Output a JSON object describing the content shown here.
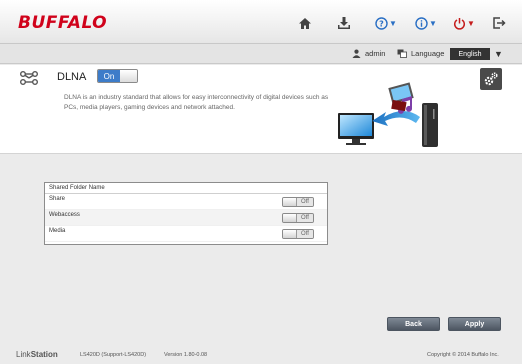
{
  "header": {
    "logo": "BUFFALO",
    "icons": [
      "home-icon",
      "download-icon",
      "help-icon",
      "info-icon",
      "power-icon",
      "logout-icon"
    ]
  },
  "userbar": {
    "user": "admin",
    "language_label": "Language",
    "language_value": "English"
  },
  "dlna": {
    "title": "DLNA",
    "toggle": "On",
    "description": "DLNA is an industry standard that allows for easy interconnectivity of digital devices such as PCs, media players, gaming devices and network attached."
  },
  "table": {
    "header": "Shared Folder Name",
    "rows": [
      {
        "name": "Share",
        "state": "Off"
      },
      {
        "name": "Webaccess",
        "state": "Off"
      },
      {
        "name": "Media",
        "state": "Off"
      }
    ]
  },
  "buttons": {
    "back": "Back",
    "apply": "Apply"
  },
  "footer": {
    "brand_link": "Link",
    "brand_station": "Station",
    "model": "LS420D (Support-LS420D)",
    "version": "Version 1.80-0.08",
    "copyright": "Copyright © 2014 Buffalo Inc."
  },
  "colors": {
    "brand_red": "#d0021b",
    "accent_blue": "#3d7cc9",
    "button": "#5b6470"
  }
}
